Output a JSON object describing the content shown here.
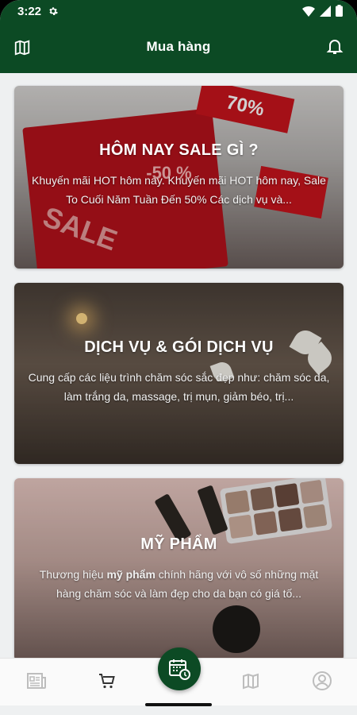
{
  "status_bar": {
    "time": "3:22"
  },
  "app_bar": {
    "title": "Mua hàng"
  },
  "cards": [
    {
      "title": "HÔM NAY SALE GÌ ?",
      "description": "Khuyến mãi HOT hôm nay. Khuyến mãi HOT hôm nay, Sale To Cuối Năm Tuần Đến 50% Các dịch vụ và...",
      "image_tags": [
        "70%",
        "-50 %",
        "SALE"
      ]
    },
    {
      "title": "DỊCH VỤ & GÓI DỊCH VỤ",
      "description": "Cung cấp các liệu trình chăm sóc sắc đẹp như: chăm sóc da, làm trắng da, massage, trị mụn, giảm béo, trị..."
    },
    {
      "title": "MỸ PHẨM",
      "description_prefix": "Thương hiệu ",
      "description_bold": "mỹ phẩm",
      "description_suffix": " chính hãng với vô số những mặt hàng chăm sóc và làm đẹp cho da bạn có giá tố..."
    }
  ],
  "bottom_nav": {
    "items": [
      {
        "icon": "news-icon",
        "active": false
      },
      {
        "icon": "cart-icon",
        "active": true
      },
      {
        "icon": "map-icon",
        "active": false
      },
      {
        "icon": "profile-icon",
        "active": false
      }
    ],
    "fab_icon": "calendar-clock-icon"
  },
  "colors": {
    "primary": "#0c4a24",
    "accent_sale": "#c8141d"
  }
}
